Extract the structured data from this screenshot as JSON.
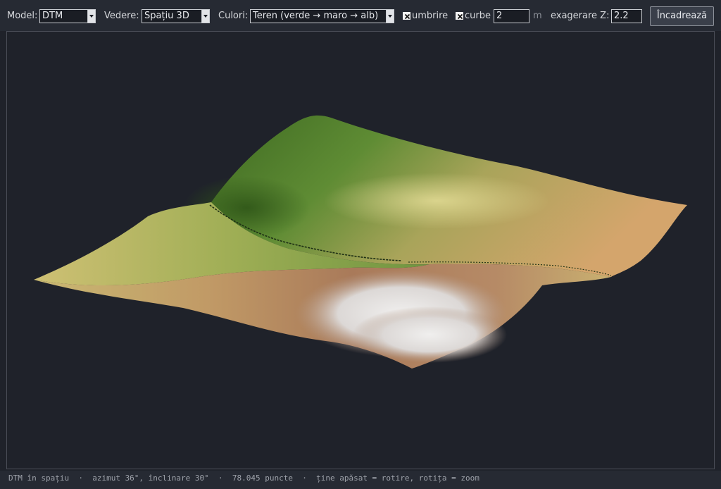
{
  "toolbar": {
    "model_label": "Model:",
    "model_value": "DTM",
    "view_label": "Vedere:",
    "view_value": "Spațiu 3D",
    "colors_label": "Culori:",
    "colors_value": "Teren (verde → maro → alb)",
    "shading_label": "umbrire",
    "shading_checked": true,
    "contours_label": "curbe",
    "contours_checked": true,
    "contour_interval": "2",
    "contour_unit": "m",
    "zexag_label": "exagerare Z:",
    "zexag_value": "2.2",
    "fit_button": "Încadrează"
  },
  "status": {
    "text": "DTM în spațiu  ·  azimut 36°, înclinare 30°  ·  78.045 puncte  ·  ține apăsat = rotire, rotița = zoom"
  },
  "colors": {
    "background": "#1f222a",
    "terrain_low": "#c8b46a",
    "terrain_green": "#4e7a2c",
    "terrain_brown": "#b88c5e",
    "terrain_snow": "#e8e6e4"
  }
}
